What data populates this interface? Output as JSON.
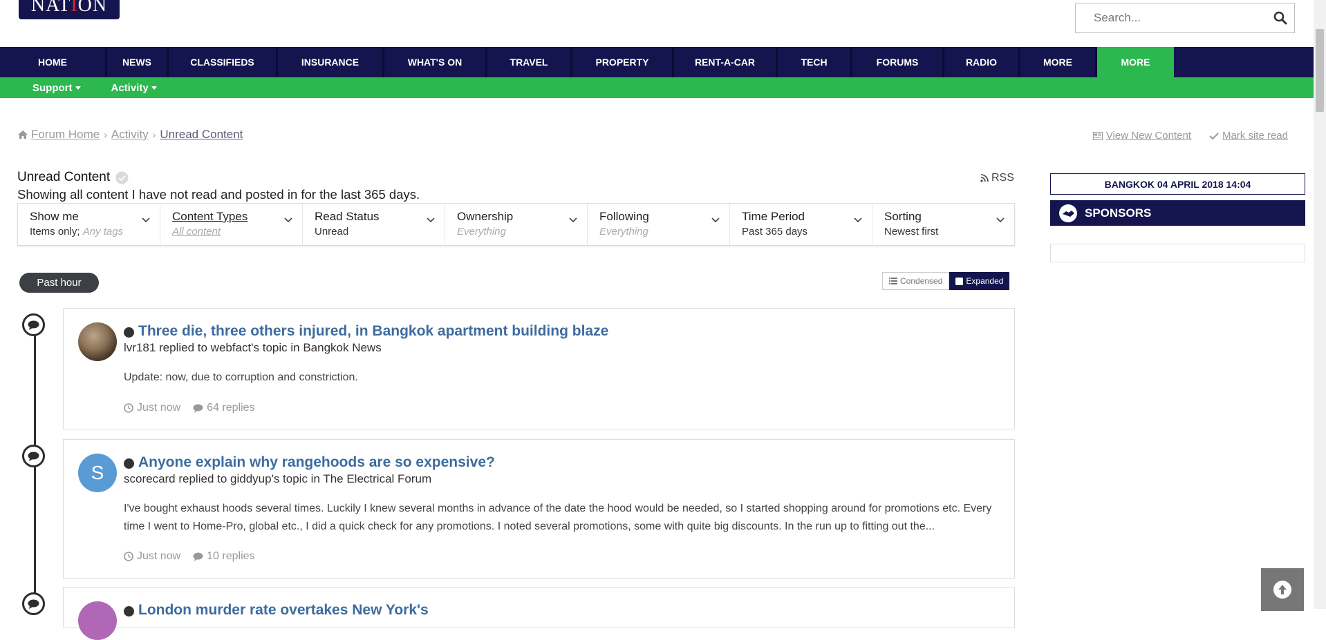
{
  "header": {
    "logo_text_a": "NAT",
    "logo_text_b": "I",
    "logo_text_c": "ON",
    "search_placeholder": "Search...",
    "search_icon": "search-icon"
  },
  "nav": {
    "items": [
      {
        "label": "HOME"
      },
      {
        "label": "NEWS"
      },
      {
        "label": "CLASSIFIEDS"
      },
      {
        "label": "INSURANCE"
      },
      {
        "label": "WHAT'S ON"
      },
      {
        "label": "TRAVEL"
      },
      {
        "label": "PROPERTY"
      },
      {
        "label": "RENT-A-CAR"
      },
      {
        "label": "TECH"
      },
      {
        "label": "FORUMS"
      },
      {
        "label": "RADIO"
      },
      {
        "label": "MORE"
      },
      {
        "label": "MORE"
      }
    ],
    "active_index": 12,
    "colors": {
      "primary": "#14154f",
      "accent": "#2db74f"
    }
  },
  "subnav": {
    "items": [
      {
        "label": "Support"
      },
      {
        "label": "Activity"
      }
    ]
  },
  "breadcrumb": {
    "home": "Forum Home",
    "activity": "Activity",
    "current": "Unread Content"
  },
  "actions": {
    "view_new": "View New Content",
    "mark_read": "Mark site read"
  },
  "page": {
    "title": "Unread Content",
    "description": "Showing all content I have not read and posted in for the last 365 days.",
    "rss": "RSS"
  },
  "filters": [
    {
      "title": "Show me",
      "value": "Items only;",
      "muted": "Any tags"
    },
    {
      "title": "Content Types",
      "value": "",
      "muted": "All content"
    },
    {
      "title": "Read Status",
      "value": "Unread",
      "muted": ""
    },
    {
      "title": "Ownership",
      "value": "",
      "muted": "Everything"
    },
    {
      "title": "Following",
      "value": "",
      "muted": "Everything"
    },
    {
      "title": "Time Period",
      "value": "Past 365 days",
      "muted": ""
    },
    {
      "title": "Sorting",
      "value": "Newest first",
      "muted": ""
    }
  ],
  "timeline": {
    "badge": "Past hour",
    "view_condensed": "Condensed",
    "view_expanded": "Expanded"
  },
  "posts": [
    {
      "title": "Three die, three others injured, in Bangkok apartment building blaze",
      "meta": "lvr181 replied to webfact's topic in Bangkok News",
      "snippet": "Update: now, due to corruption and constriction.",
      "time": "Just now",
      "replies": "64 replies"
    },
    {
      "title": "Anyone explain why rangehoods are so expensive?",
      "meta": "scorecard replied to giddyup's topic in The Electrical Forum",
      "avatar_letter": "S",
      "snippet": "I've bought exhaust hoods several times. Luckily I knew several months in advance of the date the hood would be needed, so I started shopping around for promotions etc. Every time I went to Home-Pro, global etc., I did a quick check for any promotions. I noted several promotions, some with quite big discounts. In the run up to fitting out the...",
      "time": "Just now",
      "replies": "10 replies"
    },
    {
      "title": "London murder rate overtakes New York's"
    }
  ],
  "sidebar": {
    "date": "BANGKOK 04 APRIL 2018 14:04",
    "sponsors": "SPONSORS"
  }
}
